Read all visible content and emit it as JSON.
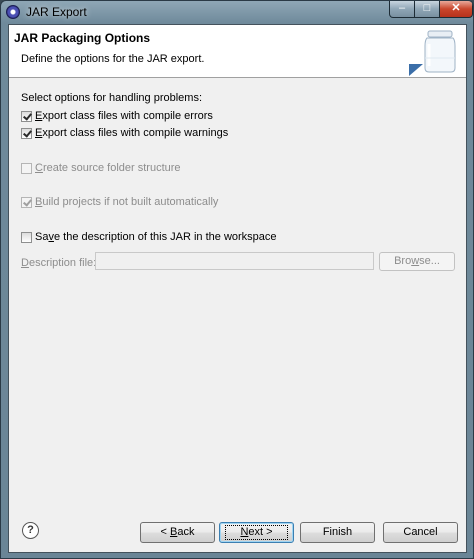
{
  "window": {
    "title": "JAR Export",
    "controls": {
      "minimize": "–",
      "maximize": "□",
      "close": "✕"
    }
  },
  "banner": {
    "title": "JAR Packaging Options",
    "description": "Define the options for the JAR export."
  },
  "options": {
    "section_label": "Select options for handling problems:",
    "export_errors": {
      "mnemonic": "E",
      "rest": "xport class files with compile errors",
      "checked": true,
      "enabled": true
    },
    "export_warnings": {
      "mnemonic": "E",
      "rest": "xport class files with compile warnings",
      "checked": true,
      "enabled": true
    },
    "source_folder": {
      "mnemonic": "C",
      "rest": "reate source folder structure",
      "checked": false,
      "enabled": false
    },
    "build_projects": {
      "mnemonic": "B",
      "rest": "uild projects if not built automatically",
      "checked": true,
      "enabled": false
    },
    "save_description": {
      "pre": "Sa",
      "mnemonic": "v",
      "rest": "e the description of this JAR in the workspace",
      "checked": false,
      "enabled": true
    }
  },
  "description_file": {
    "label_mnemonic": "D",
    "label_rest": "escription file:",
    "value": "",
    "browse_mnemonic": "w",
    "browse_pre": "Bro",
    "browse_rest": "se..."
  },
  "buttons": {
    "help": "?",
    "back_prefix": "< ",
    "back_mnemonic": "B",
    "back_rest": "ack",
    "next_mnemonic": "N",
    "next_rest": "ext >",
    "finish": "Finish",
    "cancel": "Cancel"
  },
  "icons": {
    "app": "eclipse-icon",
    "banner": "jar-icon",
    "help": "help-icon"
  }
}
